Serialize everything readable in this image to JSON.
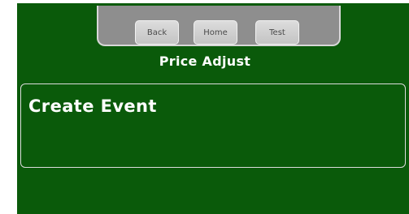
{
  "nav": {
    "back_label": "Back",
    "home_label": "Home",
    "test_label": "Test"
  },
  "page": {
    "title": "Price Adjust"
  },
  "event": {
    "label": "Create Event"
  },
  "colors": {
    "background": "#0a5a0a",
    "topbar": "#8e8e8e",
    "button": "#d0d0d0",
    "text": "#ffffff"
  }
}
